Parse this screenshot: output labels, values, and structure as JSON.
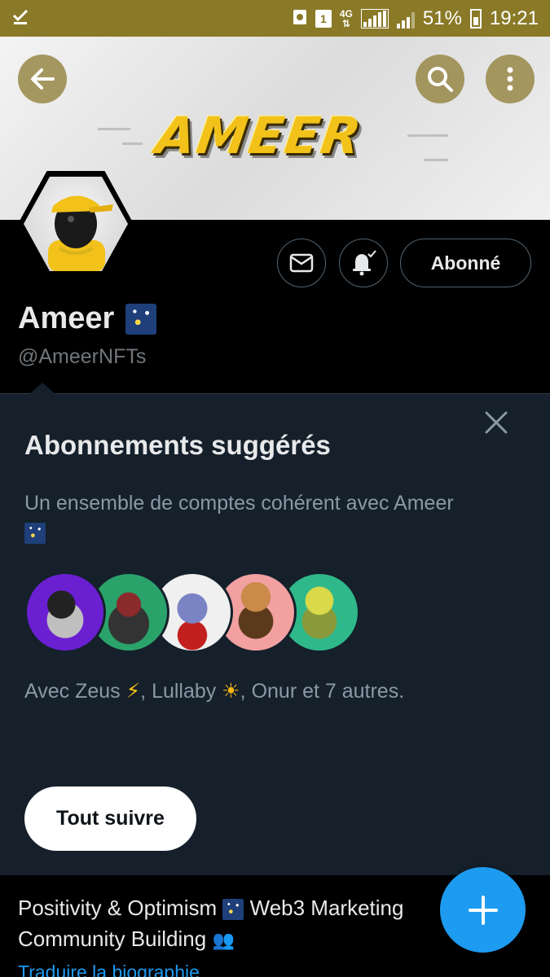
{
  "status_bar": {
    "sim_badge": "1",
    "network": "4G",
    "battery_pct": "51%",
    "time": "19:21"
  },
  "banner": {
    "logo_text": "AMEER"
  },
  "profile": {
    "name": "Ameer",
    "handle": "@AmeerNFTs",
    "follow_label": "Abonné"
  },
  "suggestions": {
    "title": "Abonnements suggérés",
    "description": "Un ensemble de comptes cohérent avec Ameer",
    "with_prefix": "Avec Zeus",
    "with_middle": ", Lullaby",
    "with_suffix": ", Onur et 7 autres.",
    "follow_all_label": "Tout suivre",
    "avatar_colors": [
      "#6a1fd1",
      "#2aa36b",
      "#f0f0f0",
      "#f2a0a0",
      "#2fb88a"
    ]
  },
  "bio": {
    "line1_a": "Positivity & Optimism",
    "line1_b": "Web3 Marketing",
    "line2": "Community Building",
    "translate_label": "Traduire la biographie"
  },
  "colors": {
    "accent": "#1d9bf0",
    "status_bar": "#8a7a28",
    "panel_bg": "#15202b"
  }
}
